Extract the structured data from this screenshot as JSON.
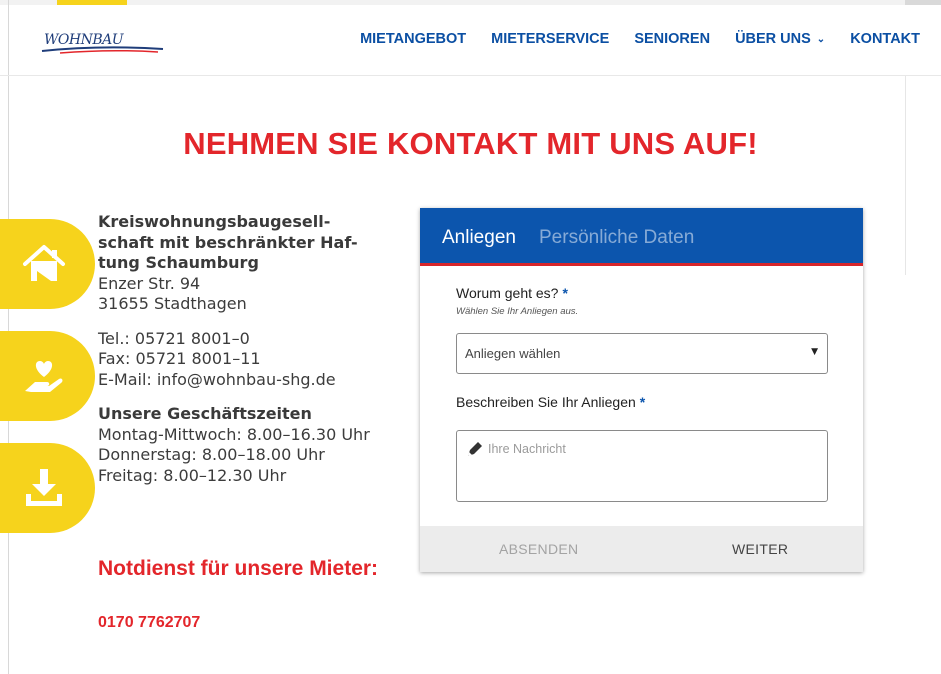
{
  "header": {
    "logo_text": "WOHNBAU",
    "nav": [
      {
        "label": "MIETANGEBOT"
      },
      {
        "label": "MIETERSERVICE"
      },
      {
        "label": "SENIOREN"
      },
      {
        "label": "ÜBER UNS"
      },
      {
        "label": "KONTAKT"
      }
    ]
  },
  "headline": "NEHMEN SIE KONTAKT MIT UNS AUF!",
  "side_buttons": [
    {
      "icon": "home-icon"
    },
    {
      "icon": "heart-hand-icon"
    },
    {
      "icon": "download-icon"
    }
  ],
  "contact": {
    "company_lines": [
      "Kreiswohnungsbaugesell-",
      "schaft mit beschränkter Haf-",
      "tung Schaumburg"
    ],
    "street": "Enzer Str. 94",
    "city": "31655 Stadthagen",
    "tel": "Tel.: 05721 8001–0",
    "fax": "Fax: 05721 8001–11",
    "email": "E-Mail: info@wohnbau-shg.de",
    "hours_title": "Unsere Geschäftszeiten",
    "hours": [
      "Montag-Mittwoch: 8.00–16.30 Uhr",
      "Donnerstag: 8.00–18.00 Uhr",
      "Freitag: 8.00–12.30 Uhr"
    ],
    "emergency_title": "Notdienst für unsere Mieter:",
    "emergency_phone": "0170 7762707"
  },
  "form": {
    "tabs": [
      {
        "label": "Anliegen",
        "active": true
      },
      {
        "label": "Persönliche Daten",
        "active": false
      }
    ],
    "topic_label": "Worum geht es?",
    "required_mark": "*",
    "topic_hint": "Wählen Sie Ihr Anliegen aus.",
    "topic_select_value": "Anliegen wählen",
    "message_label": "Beschreiben Sie Ihr Anliegen",
    "message_placeholder": "Ihre Nachricht",
    "send_label": "ABSENDEN",
    "next_label": "WEITER"
  },
  "colors": {
    "brand_blue": "#0c55ad",
    "accent_red": "#e3262b",
    "accent_yellow": "#f6d31c"
  }
}
